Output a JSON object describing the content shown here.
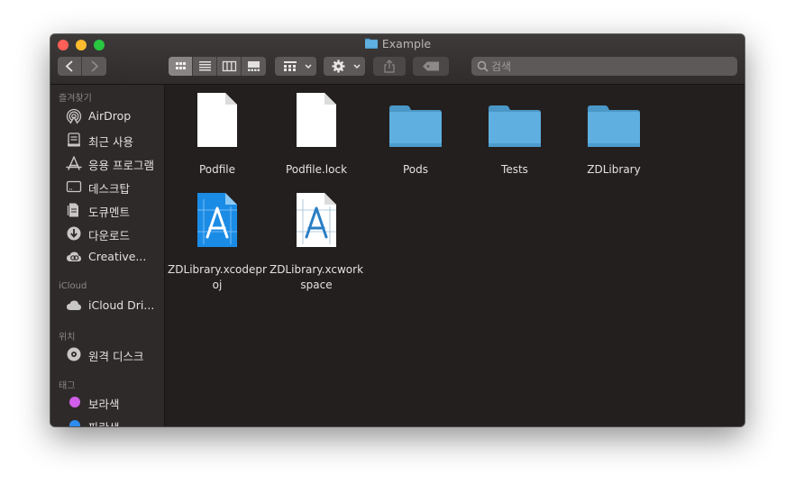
{
  "window": {
    "title": "Example"
  },
  "toolbar": {
    "back_icon": "chevron-left-icon",
    "forward_icon": "chevron-right-icon",
    "view_icons": [
      "icon-view-icon",
      "list-view-icon",
      "column-view-icon",
      "gallery-view-icon"
    ],
    "group_icon": "group-grid-icon",
    "action_icon": "gear-icon",
    "share_icon": "share-icon",
    "tag_icon": "tag-icon"
  },
  "search": {
    "placeholder": "검색"
  },
  "sidebar": {
    "favorites_header": "즐겨찾기",
    "favorites": [
      {
        "label": "AirDrop",
        "icon": "airdrop-icon"
      },
      {
        "label": "최근 사용",
        "icon": "recents-icon"
      },
      {
        "label": "응용 프로그램",
        "icon": "applications-icon"
      },
      {
        "label": "데스크탑",
        "icon": "desktop-icon"
      },
      {
        "label": "도큐멘트",
        "icon": "documents-icon"
      },
      {
        "label": "다운로드",
        "icon": "downloads-icon"
      },
      {
        "label": "Creative...",
        "icon": "creative-cloud-icon"
      }
    ],
    "icloud_header": "iCloud",
    "icloud": [
      {
        "label": "iCloud Dri...",
        "icon": "cloud-icon"
      }
    ],
    "locations_header": "위치",
    "locations": [
      {
        "label": "원격 디스크",
        "icon": "disc-icon"
      }
    ],
    "tags_header": "태그",
    "tags": [
      {
        "label": "보라색",
        "color": "#d15ee8"
      },
      {
        "label": "파란색",
        "color": "#2f8cf0"
      }
    ]
  },
  "files": [
    {
      "name": "Podfile",
      "icon": "document-icon"
    },
    {
      "name": "Podfile.lock",
      "icon": "document-icon"
    },
    {
      "name": "Pods",
      "icon": "folder-icon"
    },
    {
      "name": "Tests",
      "icon": "folder-icon"
    },
    {
      "name": "ZDLibrary",
      "icon": "folder-icon"
    },
    {
      "name": "ZDLibrary.xcodeproj",
      "icon": "xcodeproj-icon"
    },
    {
      "name": "ZDLibrary.xcworkspace",
      "icon": "xcworkspace-icon"
    }
  ],
  "colors": {
    "folder": "#5aa7d6",
    "window_bg": "#231f1e",
    "sidebar_bg": "#2e2a29"
  }
}
